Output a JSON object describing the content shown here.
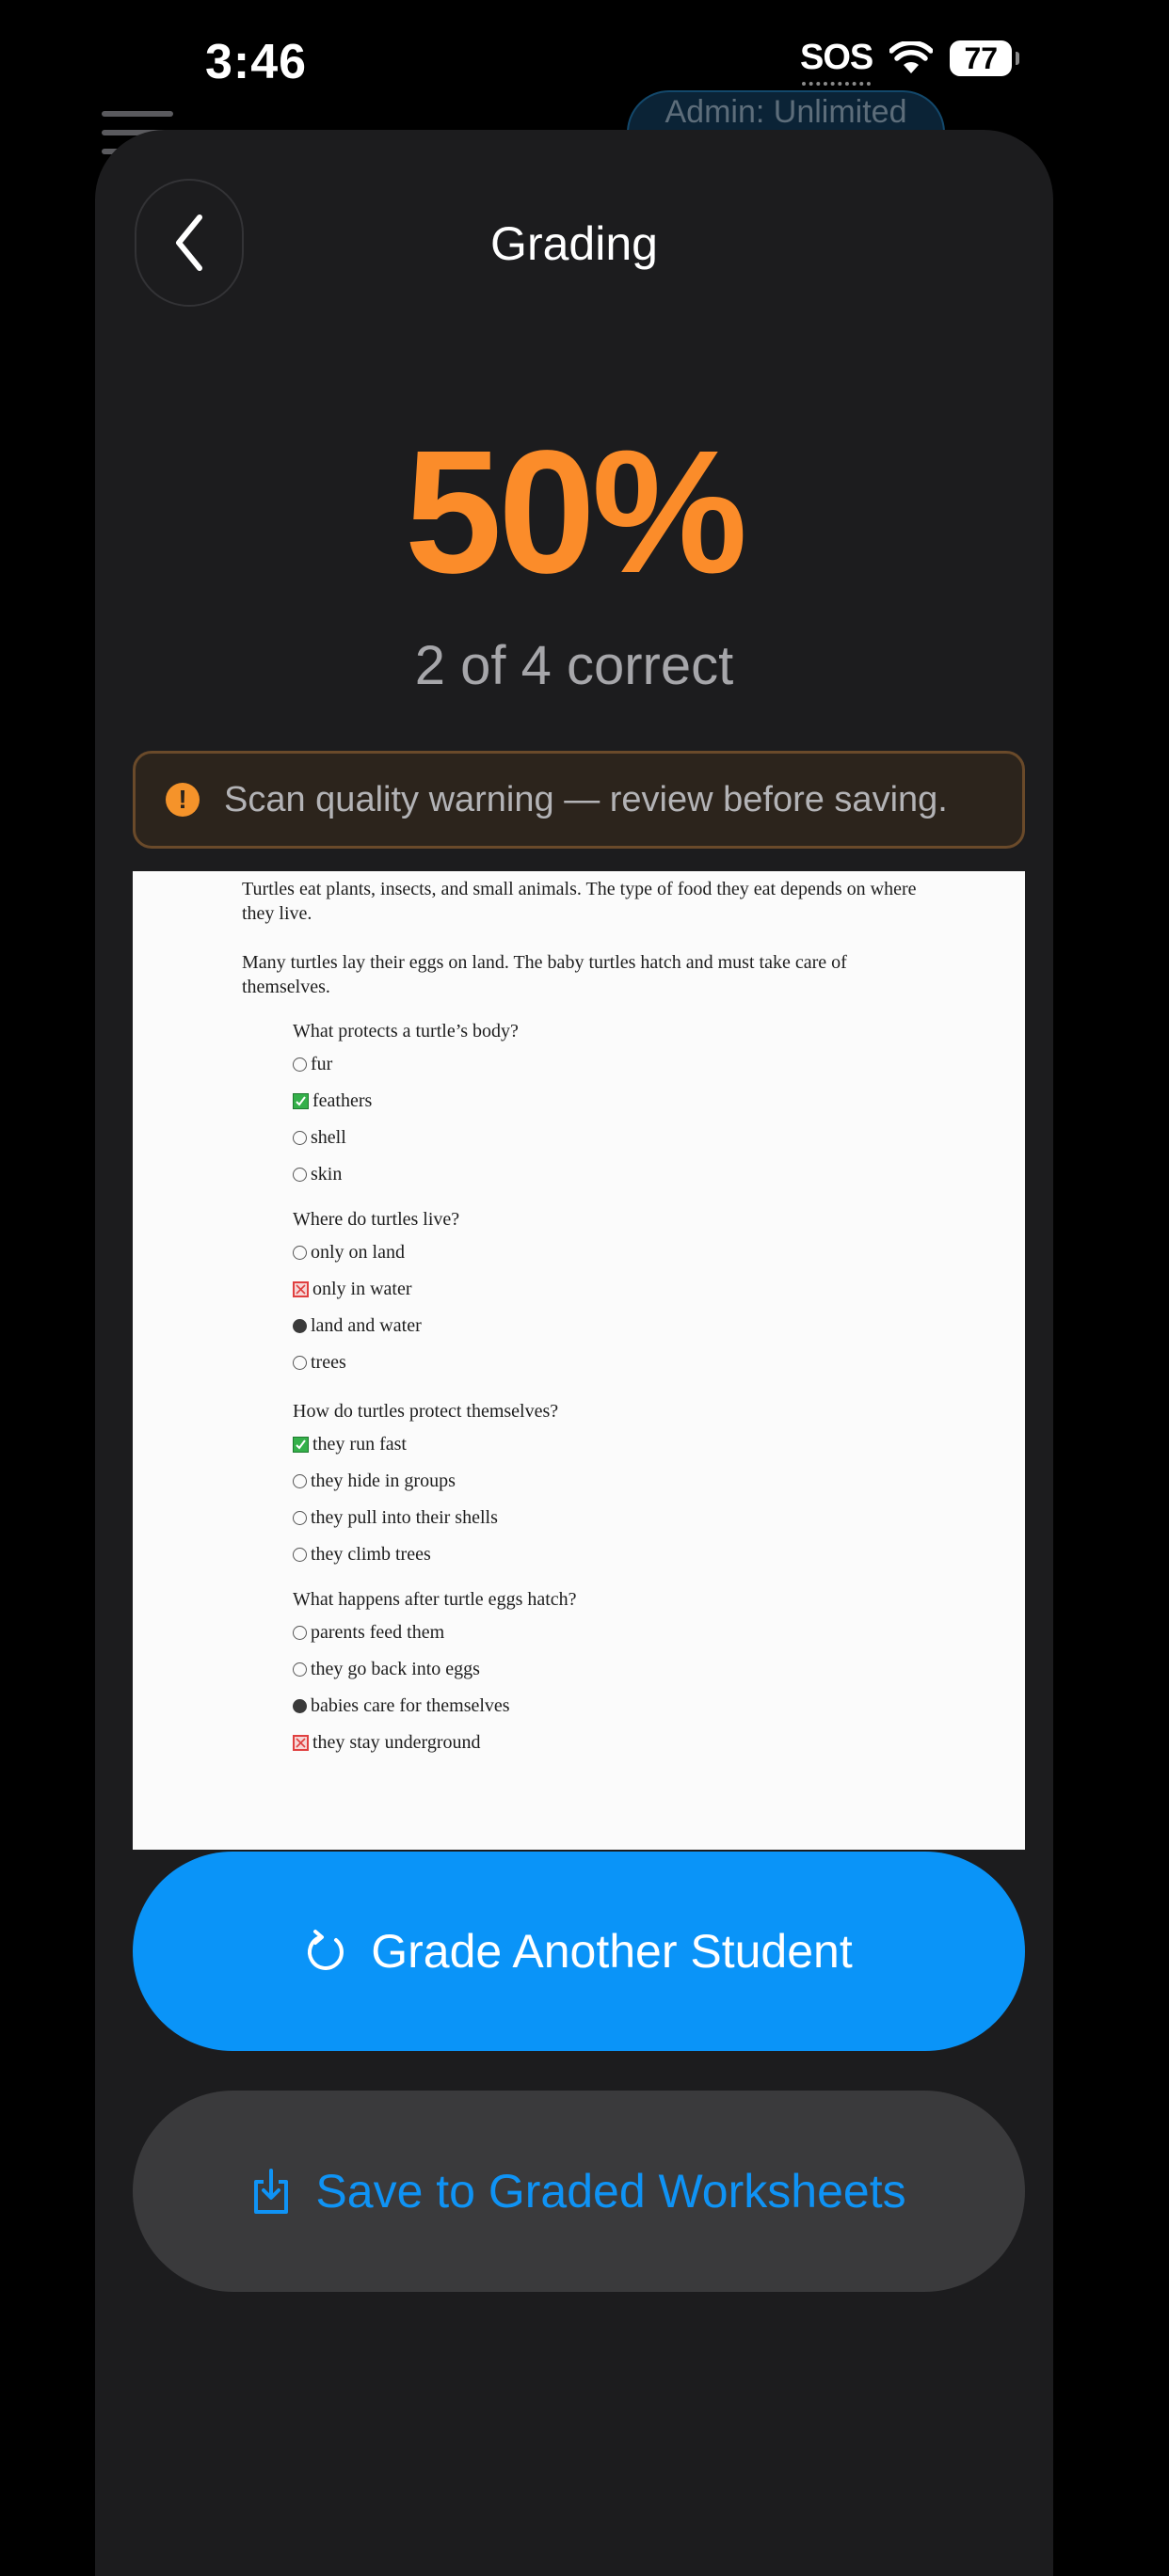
{
  "status_bar": {
    "time": "3:46",
    "sos": "SOS",
    "battery": "77"
  },
  "background": {
    "plan_pill": "Admin: Unlimited"
  },
  "header": {
    "title": "Grading"
  },
  "score": {
    "percent": "50%",
    "detail": "2 of 4 correct"
  },
  "warning": {
    "text": "Scan quality warning — review before saving.",
    "icon": "!"
  },
  "worksheet": {
    "intro": [
      "Turtles eat plants, insects, and small animals. The type of food they eat depends on where they live.",
      "Many turtles lay their eggs on land. The baby turtles hatch and must take care of themselves."
    ],
    "questions": [
      {
        "text": "What protects a turtle’s body?",
        "options": [
          {
            "label": "fur",
            "mark": "radio"
          },
          {
            "label": "feathers",
            "mark": "correct"
          },
          {
            "label": "shell",
            "mark": "radio"
          },
          {
            "label": "skin",
            "mark": "radio"
          }
        ]
      },
      {
        "text": "Where do turtles live?",
        "options": [
          {
            "label": "only on land",
            "mark": "radio"
          },
          {
            "label": "only in water",
            "mark": "wrong"
          },
          {
            "label": "land and water",
            "mark": "filled"
          },
          {
            "label": "trees",
            "mark": "radio"
          }
        ]
      },
      {
        "text": "How do turtles protect themselves?",
        "options": [
          {
            "label": "they run fast",
            "mark": "correct"
          },
          {
            "label": "they hide in groups",
            "mark": "radio"
          },
          {
            "label": "they pull into their shells",
            "mark": "radio"
          },
          {
            "label": "they climb trees",
            "mark": "radio"
          }
        ]
      },
      {
        "text": "What happens after turtle eggs hatch?",
        "options": [
          {
            "label": "parents feed them",
            "mark": "radio"
          },
          {
            "label": "they go back into eggs",
            "mark": "radio"
          },
          {
            "label": "babies care for themselves",
            "mark": "filled"
          },
          {
            "label": "they stay underground",
            "mark": "wrong"
          }
        ]
      }
    ]
  },
  "actions": {
    "grade_another": "Grade Another Student",
    "save": "Save to Graded Worksheets"
  },
  "colors": {
    "accent_orange": "#fb8c2a",
    "primary_blue": "#0a94f8",
    "correct_green": "#34b04a",
    "wrong_red": "#e04040"
  }
}
